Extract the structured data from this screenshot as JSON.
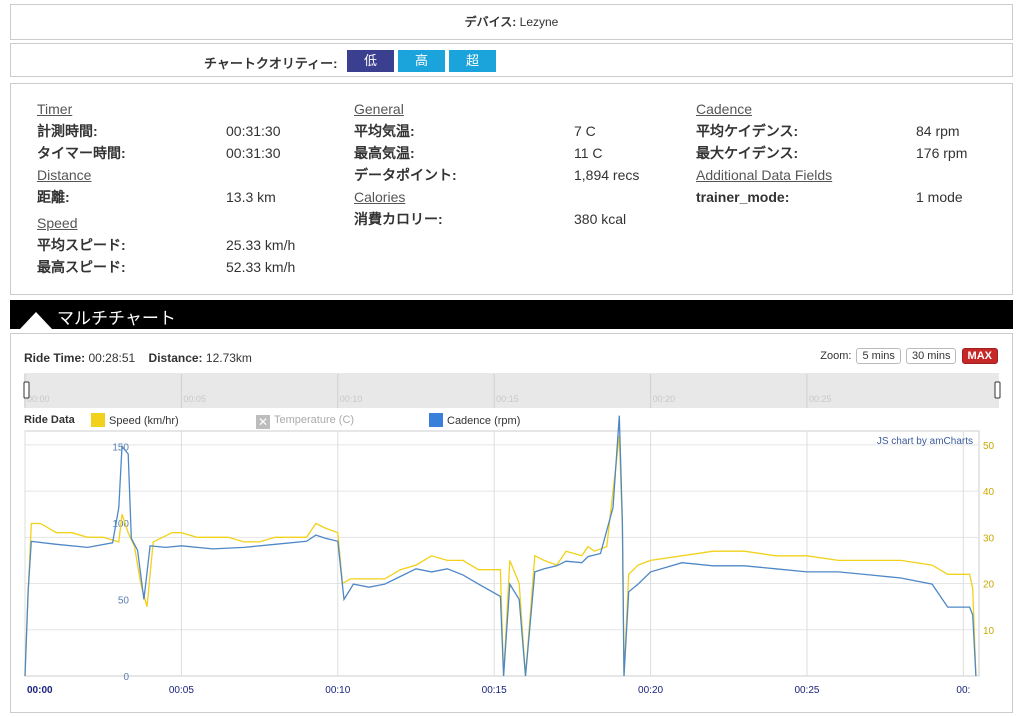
{
  "device": {
    "label": "デバイス:",
    "value": "Lezyne"
  },
  "quality": {
    "label": "チャートクオリティー:",
    "options": [
      "低",
      "高",
      "超"
    ],
    "selected": "低"
  },
  "stats": {
    "col1": {
      "timer": {
        "title": "Timer",
        "rows": [
          [
            "計測時間:",
            "00:31:30"
          ],
          [
            "タイマー時間:",
            "00:31:30"
          ]
        ]
      },
      "distance": {
        "title": "Distance",
        "rows": [
          [
            "距離:",
            "13.3 km"
          ]
        ]
      },
      "speed": {
        "title": "Speed",
        "rows": [
          [
            "平均スピード:",
            "25.33 km/h"
          ],
          [
            "最高スピード:",
            "52.33 km/h"
          ]
        ]
      }
    },
    "col2": {
      "general": {
        "title": "General",
        "rows": [
          [
            "平均気温:",
            "7 C"
          ],
          [
            "最高気温:",
            "11 C"
          ],
          [
            "データポイント:",
            "1,894 recs"
          ]
        ]
      },
      "calories": {
        "title": "Calories",
        "rows": [
          [
            "消費カロリー:",
            "380 kcal"
          ]
        ]
      }
    },
    "col3": {
      "cadence": {
        "title": "Cadence",
        "rows": [
          [
            "平均ケイデンス:",
            "84 rpm"
          ],
          [
            "最大ケイデンス:",
            "176 rpm"
          ]
        ]
      },
      "additional": {
        "title": "Additional Data Fields",
        "rows": [
          [
            "trainer_mode:",
            "1 mode"
          ]
        ]
      }
    }
  },
  "chart_header": {
    "title": "マルチチャート"
  },
  "ride_info": {
    "time_label": "Ride Time:",
    "time_value": "00:28:51",
    "dist_label": "Distance:",
    "dist_value": "12.73km"
  },
  "zoom": {
    "label": "Zoom:",
    "options": [
      "5 mins",
      "30 mins",
      "MAX"
    ],
    "active": "MAX"
  },
  "legend": {
    "title": "Ride Data",
    "items": [
      {
        "name": "Speed (km/hr)",
        "color": "#f2d11a",
        "enabled": true
      },
      {
        "name": "Temperature (C)",
        "color": "#bdbdbd",
        "enabled": false
      },
      {
        "name": "Cadence (rpm)",
        "color": "#3a7fd9",
        "enabled": true
      }
    ]
  },
  "credit": "JS chart by amCharts",
  "chart_data": {
    "type": "line",
    "x_ticks": [
      "00:00",
      "00:05",
      "00:10",
      "00:15",
      "00:20",
      "00:25",
      "00:"
    ],
    "scroll_ticks": [
      "00:00",
      "00:05",
      "00:10",
      "00:15",
      "00:20",
      "00:25"
    ],
    "left_axis": {
      "ticks": [
        0,
        50,
        100,
        150
      ],
      "range": [
        0,
        160
      ]
    },
    "right_axis": {
      "ticks": [
        10,
        20,
        30,
        40,
        50
      ],
      "range": [
        0,
        53
      ]
    },
    "x_range_min": [
      0,
      30.5
    ],
    "series": [
      {
        "name": "Speed (km/hr)",
        "axis": "right",
        "points": [
          [
            0,
            0
          ],
          [
            0.1,
            18
          ],
          [
            0.2,
            33
          ],
          [
            0.5,
            33
          ],
          [
            1,
            31
          ],
          [
            1.5,
            31
          ],
          [
            2,
            30
          ],
          [
            2.5,
            30
          ],
          [
            3,
            29
          ],
          [
            3.1,
            35
          ],
          [
            3.3,
            31
          ],
          [
            3.5,
            28
          ],
          [
            3.7,
            20
          ],
          [
            3.9,
            15
          ],
          [
            4.1,
            29
          ],
          [
            4.4,
            30
          ],
          [
            4.7,
            31
          ],
          [
            5,
            31
          ],
          [
            5.5,
            30
          ],
          [
            6,
            30
          ],
          [
            6.5,
            30
          ],
          [
            7,
            29
          ],
          [
            7.5,
            29
          ],
          [
            8,
            30
          ],
          [
            8.5,
            30
          ],
          [
            9,
            30
          ],
          [
            9.3,
            33
          ],
          [
            9.6,
            32
          ],
          [
            10,
            31
          ],
          [
            10.15,
            20
          ],
          [
            10.4,
            21
          ],
          [
            11,
            21
          ],
          [
            11.5,
            21
          ],
          [
            12,
            23
          ],
          [
            12.5,
            24
          ],
          [
            13,
            26
          ],
          [
            13.5,
            25
          ],
          [
            14,
            25
          ],
          [
            14.5,
            23
          ],
          [
            15.2,
            23
          ],
          [
            15.3,
            0
          ],
          [
            15.5,
            25
          ],
          [
            15.8,
            20
          ],
          [
            16,
            0
          ],
          [
            16.3,
            26
          ],
          [
            16.6,
            25
          ],
          [
            17,
            24
          ],
          [
            17.3,
            27
          ],
          [
            17.8,
            26
          ],
          [
            18,
            28
          ],
          [
            18.2,
            27
          ],
          [
            18.6,
            28
          ],
          [
            18.8,
            40
          ],
          [
            19.0,
            52
          ],
          [
            19.1,
            32
          ],
          [
            19.15,
            0
          ],
          [
            19.3,
            22
          ],
          [
            19.6,
            24
          ],
          [
            20,
            25
          ],
          [
            21,
            26
          ],
          [
            22,
            27
          ],
          [
            23,
            27
          ],
          [
            24,
            26
          ],
          [
            25,
            26
          ],
          [
            26,
            25
          ],
          [
            27,
            25
          ],
          [
            28,
            25
          ],
          [
            29,
            24
          ],
          [
            29.5,
            22
          ],
          [
            30,
            22
          ],
          [
            30.2,
            22
          ],
          [
            30.3,
            19
          ],
          [
            30.4,
            0
          ]
        ]
      },
      {
        "name": "Cadence (rpm)",
        "axis": "left",
        "points": [
          [
            0,
            0
          ],
          [
            0.1,
            55
          ],
          [
            0.2,
            88
          ],
          [
            1,
            86
          ],
          [
            2,
            84
          ],
          [
            2.8,
            87
          ],
          [
            3.0,
            110
          ],
          [
            3.1,
            150
          ],
          [
            3.3,
            145
          ],
          [
            3.4,
            90
          ],
          [
            3.6,
            82
          ],
          [
            3.8,
            50
          ],
          [
            4.0,
            85
          ],
          [
            4.5,
            84
          ],
          [
            5,
            85
          ],
          [
            6,
            83
          ],
          [
            7,
            84
          ],
          [
            8,
            86
          ],
          [
            9,
            88
          ],
          [
            9.3,
            92
          ],
          [
            9.6,
            90
          ],
          [
            10,
            88
          ],
          [
            10.2,
            50
          ],
          [
            10.5,
            60
          ],
          [
            11,
            58
          ],
          [
            11.5,
            60
          ],
          [
            12,
            65
          ],
          [
            12.5,
            70
          ],
          [
            13,
            68
          ],
          [
            13.5,
            70
          ],
          [
            14,
            66
          ],
          [
            14.5,
            60
          ],
          [
            15.2,
            52
          ],
          [
            15.3,
            0
          ],
          [
            15.5,
            60
          ],
          [
            15.8,
            50
          ],
          [
            16,
            0
          ],
          [
            16.3,
            68
          ],
          [
            16.6,
            70
          ],
          [
            17,
            72
          ],
          [
            17.3,
            75
          ],
          [
            17.8,
            74
          ],
          [
            18,
            78
          ],
          [
            18.4,
            80
          ],
          [
            18.8,
            110
          ],
          [
            19.0,
            170
          ],
          [
            19.1,
            100
          ],
          [
            19.15,
            0
          ],
          [
            19.3,
            55
          ],
          [
            19.6,
            60
          ],
          [
            20,
            68
          ],
          [
            21,
            74
          ],
          [
            22,
            72
          ],
          [
            23,
            72
          ],
          [
            24,
            70
          ],
          [
            25,
            68
          ],
          [
            26,
            68
          ],
          [
            27,
            66
          ],
          [
            28,
            64
          ],
          [
            29,
            60
          ],
          [
            29.5,
            45
          ],
          [
            30,
            45
          ],
          [
            30.2,
            45
          ],
          [
            30.3,
            40
          ],
          [
            30.4,
            0
          ]
        ]
      }
    ]
  }
}
